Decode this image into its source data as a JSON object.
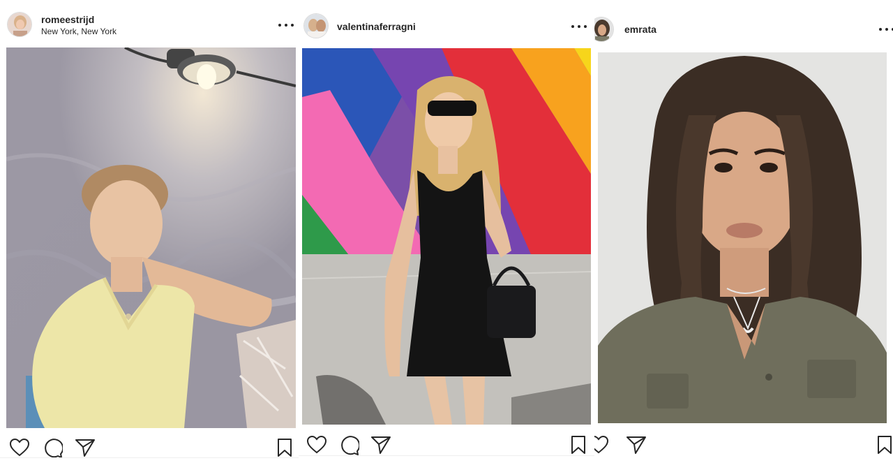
{
  "posts": [
    {
      "username": "romeestrijd",
      "location": "New York, New York",
      "photo_alt": "Woman in yellow blouse sitting against a concrete wall under a lamp"
    },
    {
      "username": "valentinaferragni",
      "location": "",
      "photo_alt": "Woman in black dress and sunglasses in front of a rainbow striped wall"
    },
    {
      "username": "emrata",
      "location": "",
      "photo_alt": "Close-up portrait of a woman with long brown hair in an olive shirt"
    }
  ],
  "icons": {
    "more": "more-options-icon",
    "like": "heart-icon",
    "comment": "comment-icon",
    "share": "share-icon",
    "save": "bookmark-icon"
  },
  "colors": {
    "text": "#262626",
    "border": "#dbdbdb"
  }
}
